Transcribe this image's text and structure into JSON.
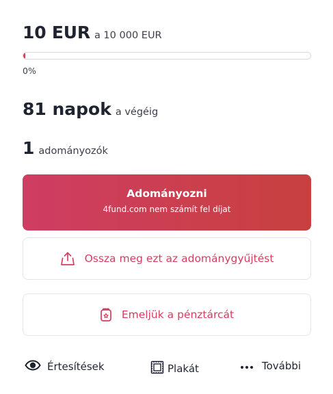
{
  "raised": {
    "amount": "10 EUR",
    "goal": "a 10 000 EUR"
  },
  "progress": {
    "fraction": 0.001,
    "label": "0%"
  },
  "days": {
    "value": "81 napok",
    "label": "a végéig"
  },
  "donors": {
    "value": "1",
    "label": "adományozók"
  },
  "donate_button": {
    "title": "Adományozni",
    "subtitle": "4fund.com nem számít fel díjat"
  },
  "share_button": {
    "label": "Ossza meg ezt az adománygyűjtést",
    "icon": "share-icon"
  },
  "wallet_button": {
    "label": "Emeljük a pénztárcát",
    "icon": "wallet-icon"
  },
  "actions": {
    "notifications": {
      "label": "Értesítések",
      "icon": "eye-icon"
    },
    "poster": {
      "label": "Plakát",
      "icon": "poster-icon"
    },
    "more": {
      "label": "További",
      "icon": "more-dots-icon"
    }
  },
  "colors": {
    "accent": "#d63e5e",
    "gradient_start": "#cf3d63",
    "gradient_end": "#c8403e"
  }
}
